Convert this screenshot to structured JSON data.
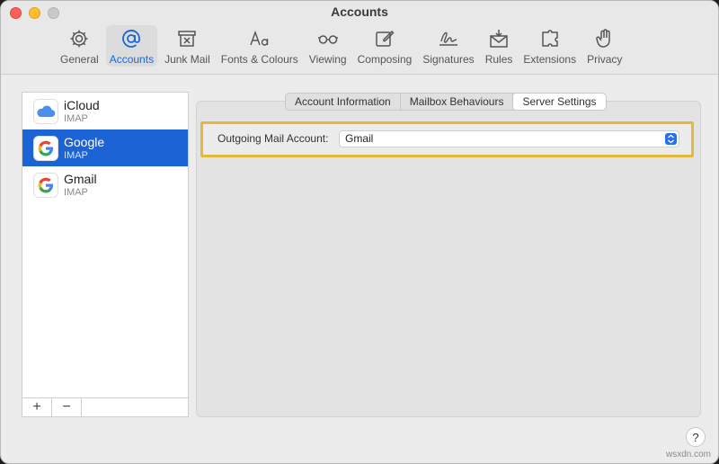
{
  "window": {
    "title": "Accounts"
  },
  "toolbar": {
    "tabs": [
      {
        "label": "General",
        "icon": "gear-icon"
      },
      {
        "label": "Accounts",
        "icon": "at-sign-icon",
        "active": true
      },
      {
        "label": "Junk Mail",
        "icon": "junk-bin-icon"
      },
      {
        "label": "Fonts & Colours",
        "icon": "font-aa-icon"
      },
      {
        "label": "Viewing",
        "icon": "glasses-icon"
      },
      {
        "label": "Composing",
        "icon": "compose-pencil-icon"
      },
      {
        "label": "Signatures",
        "icon": "signature-icon"
      },
      {
        "label": "Rules",
        "icon": "rules-envelope-icon"
      },
      {
        "label": "Extensions",
        "icon": "puzzle-icon"
      },
      {
        "label": "Privacy",
        "icon": "hand-icon"
      }
    ]
  },
  "accounts": [
    {
      "name": "iCloud",
      "type": "IMAP",
      "icon": "icloud-icon",
      "selected": false
    },
    {
      "name": "Google",
      "type": "IMAP",
      "icon": "google-icon",
      "selected": true
    },
    {
      "name": "Gmail",
      "type": "IMAP",
      "icon": "google-icon",
      "selected": false
    }
  ],
  "sidebar_buttons": {
    "add": "+",
    "remove": "−"
  },
  "segments": [
    {
      "label": "Account Information",
      "active": false
    },
    {
      "label": "Mailbox Behaviours",
      "active": false
    },
    {
      "label": "Server Settings",
      "active": true
    }
  ],
  "server_settings": {
    "outgoing_label": "Outgoing Mail Account:",
    "outgoing_value": "Gmail"
  },
  "help": "?",
  "watermark": "wsxdn.com",
  "colors": {
    "accent": "#1c63d5",
    "highlight": "#e5b93a"
  }
}
